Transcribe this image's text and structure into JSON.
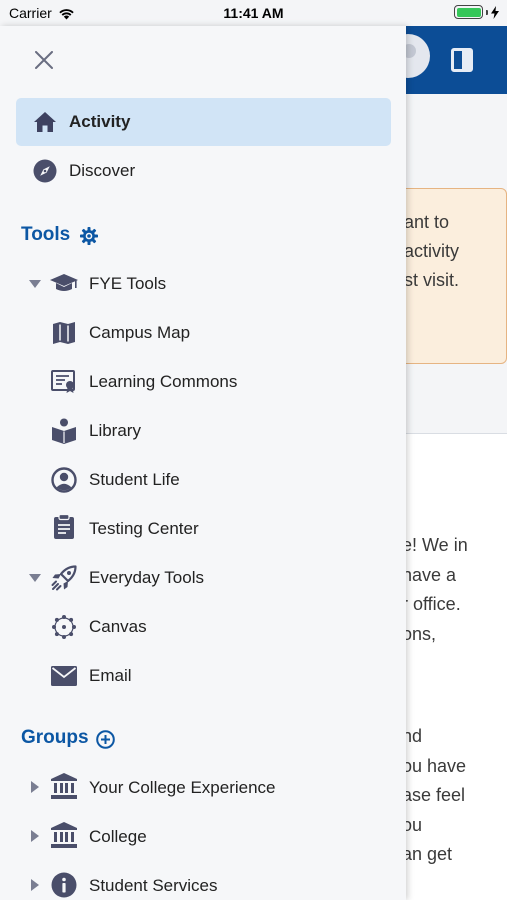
{
  "status_bar": {
    "carrier": "Carrier",
    "time": "11:41 AM"
  },
  "drawer": {
    "nav": [
      {
        "label": "Activity",
        "icon": "home-icon",
        "active": true
      },
      {
        "label": "Discover",
        "icon": "compass-icon",
        "active": false
      }
    ],
    "tools": {
      "title": "Tools",
      "settings_icon": "gear-icon",
      "groups": [
        {
          "label": "FYE Tools",
          "icon": "graduation-cap-icon",
          "expanded": true,
          "items": [
            {
              "label": "Campus Map",
              "icon": "map-icon"
            },
            {
              "label": "Learning Commons",
              "icon": "certificate-icon"
            },
            {
              "label": "Library",
              "icon": "reading-icon"
            },
            {
              "label": "Student Life",
              "icon": "user-circle-icon"
            },
            {
              "label": "Testing Center",
              "icon": "clipboard-icon"
            }
          ]
        },
        {
          "label": "Everyday Tools",
          "icon": "rocket-icon",
          "expanded": true,
          "items": [
            {
              "label": "Canvas",
              "icon": "canvas-icon"
            },
            {
              "label": "Email",
              "icon": "envelope-icon"
            }
          ]
        }
      ]
    },
    "groups": {
      "title": "Groups",
      "add_icon": "plus-circle-icon",
      "items": [
        {
          "label": "Your College Experience",
          "icon": "institution-icon"
        },
        {
          "label": "College",
          "icon": "institution-icon"
        },
        {
          "label": "Student Services",
          "icon": "info-icon"
        }
      ]
    }
  },
  "background": {
    "banner_lines": [
      "ant to",
      "activity",
      "st visit."
    ],
    "body_lines_1": [
      "e! We in",
      "nave a",
      "r office.",
      "ons,"
    ],
    "body_lines_2": [
      "nd",
      "ou have",
      "ase feel",
      "ou",
      "an get"
    ]
  },
  "colors": {
    "header": "#0c4d96",
    "active_nav": "#d1e4f6",
    "section_title": "#0c57a4",
    "icon": "#4a4e6a"
  }
}
